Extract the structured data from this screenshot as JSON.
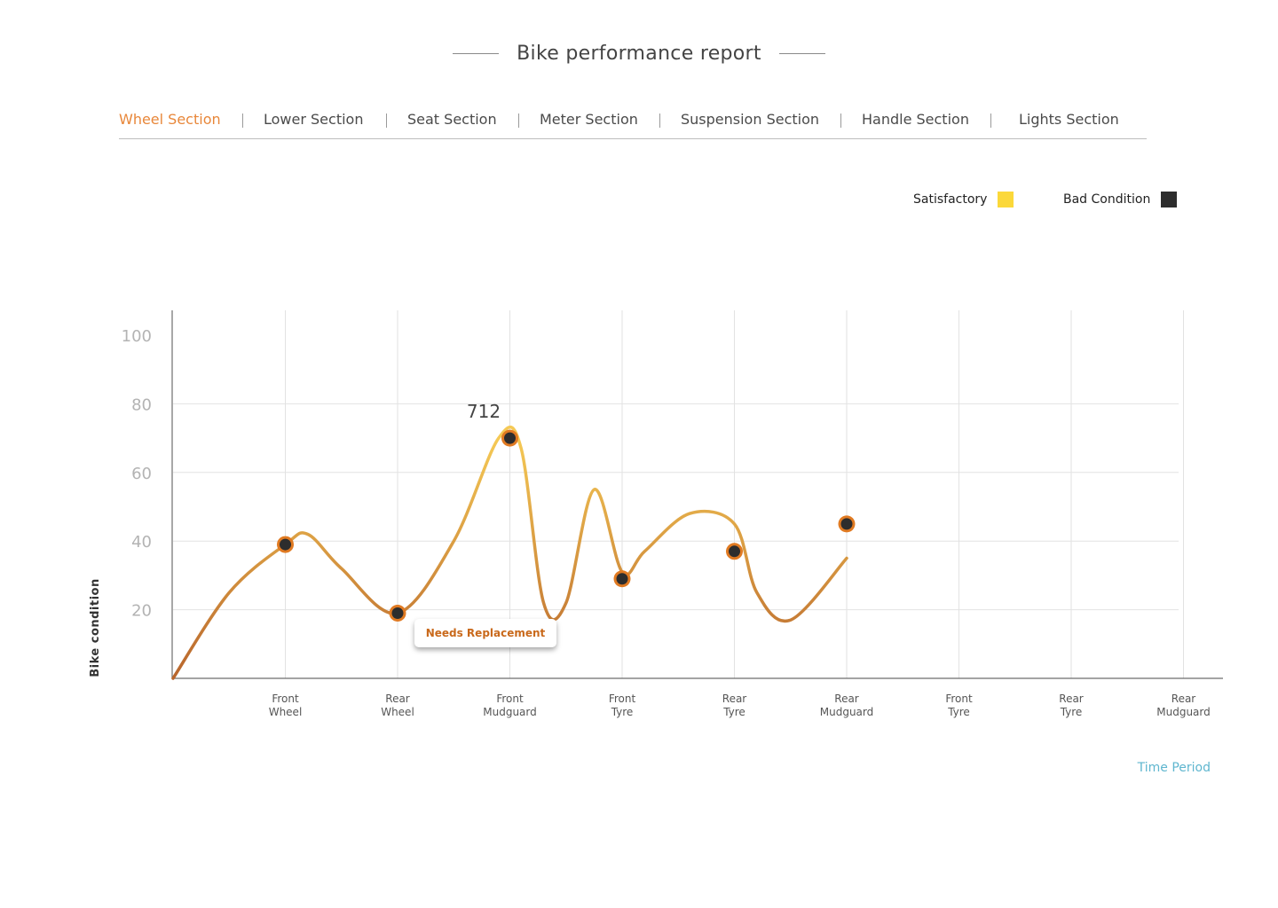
{
  "header": {
    "title": "Bike performance report"
  },
  "tabs": [
    {
      "label": "Wheel Section",
      "active": true
    },
    {
      "label": "Lower Section",
      "active": false
    },
    {
      "label": "Seat Section",
      "active": false
    },
    {
      "label": "Meter Section",
      "active": false
    },
    {
      "label": "Suspension Section",
      "active": false
    },
    {
      "label": "Handle Section",
      "active": false
    },
    {
      "label": "Lights Section",
      "active": false
    }
  ],
  "colors": {
    "accent": "#e8873a",
    "satisfactory": "#fbd83a",
    "bad_condition": "#2d2d2d",
    "line_low": "#b8652c",
    "line_high": "#f5c955",
    "time_period": "#5fb6cf"
  },
  "chart_data": {
    "type": "line",
    "ylabel": "Bike condition",
    "xlabel": "Time Period",
    "y_ticks": [
      20,
      40,
      60,
      80,
      100
    ],
    "ylim": [
      0,
      110
    ],
    "grid": true,
    "legend_position": "top-right",
    "legend": [
      {
        "name": "Satisfactory",
        "color": "#fbd83a"
      },
      {
        "name": "Bad Condition",
        "color": "#2d2d2d"
      }
    ],
    "categories": [
      "Front Wheel",
      "Rear Wheel",
      "Front Mudguard",
      "Front Tyre",
      "Rear Tyre",
      "Rear Mudguard",
      "Front Tyre",
      "Rear Tyre",
      "Rear Mudguard"
    ],
    "category_lines": [
      [
        "Front",
        "Wheel"
      ],
      [
        "Rear",
        "Wheel"
      ],
      [
        "Front",
        "Mudguard"
      ],
      [
        "Front",
        "Tyre"
      ],
      [
        "Rear",
        "Tyre"
      ],
      [
        "Rear",
        "Mudguard"
      ],
      [
        "Front",
        "Tyre"
      ],
      [
        "Rear",
        "Tyre"
      ],
      [
        "Rear",
        "Mudguard"
      ]
    ],
    "series": [
      {
        "values": [
          39,
          19,
          70,
          29,
          37,
          45
        ],
        "curve": [
          [
            0,
            0
          ],
          [
            0.5,
            25
          ],
          [
            1,
            39
          ],
          [
            1.2,
            42
          ],
          [
            1.5,
            32
          ],
          [
            2,
            19
          ],
          [
            2.5,
            40
          ],
          [
            2.9,
            70
          ],
          [
            3.1,
            67
          ],
          [
            3.3,
            22
          ],
          [
            3.5,
            22
          ],
          [
            3.75,
            55
          ],
          [
            4,
            31
          ],
          [
            4.2,
            37
          ],
          [
            4.6,
            48
          ],
          [
            5,
            45
          ],
          [
            5.2,
            25
          ],
          [
            5.5,
            17
          ],
          [
            6,
            35
          ]
        ]
      }
    ],
    "annotations": [
      {
        "category_index": 2,
        "text": "712"
      },
      {
        "category_index": 1,
        "text": "Needs Replacement"
      }
    ]
  }
}
